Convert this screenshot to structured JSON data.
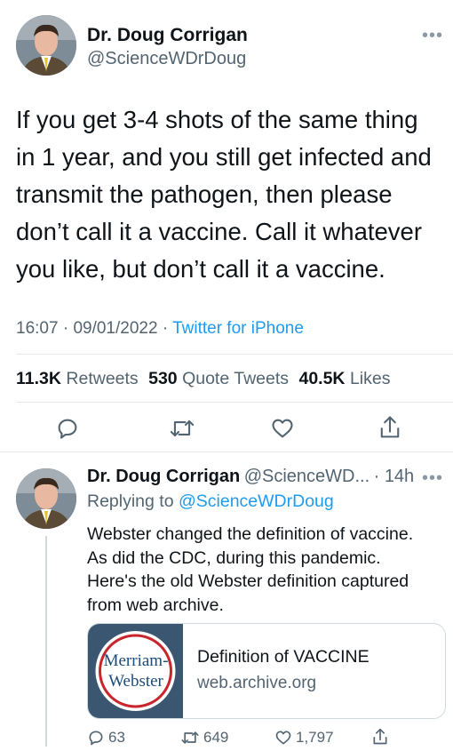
{
  "main_tweet": {
    "author_name": "Dr. Doug Corrigan",
    "author_handle": "@ScienceWDrDoug",
    "more_icon": "more-icon",
    "text_lines": [
      "If you get 3-4 shots of the same thing",
      "in 1 year, and you still get infected and",
      "transmit the pathogen, then please",
      "don’t call it a vaccine. Call it whatever",
      "you like, but don’t call it a vaccine."
    ],
    "time": "16:07",
    "date": "09/01/2022",
    "source": "Twitter for iPhone",
    "retweets_count": "11.3K",
    "retweets_label": "Retweets",
    "quotes_count": "530",
    "quotes_label": "Quote Tweets",
    "likes_count": "40.5K",
    "likes_label": "Likes"
  },
  "reply": {
    "author_name": "Dr. Doug Corrigan",
    "author_handle": "@ScienceWD...",
    "age": "14h",
    "replying_prefix": "Replying to",
    "replying_to": "@ScienceWDrDoug",
    "text_lines": [
      "Webster changed the definition of vaccine.",
      "As did the CDC, during this pandemic.",
      "Here's the old Webster definition captured",
      "from web archive."
    ],
    "card": {
      "logo_line1": "Merriam-",
      "logo_line2": "Webster",
      "title": "Definition of VACCINE",
      "domain": "web.archive.org"
    },
    "replies_count": "63",
    "retweets_count": "649",
    "likes_count": "1,797"
  },
  "colors": {
    "accent": "#1d9bf0",
    "text": "#0f1419",
    "secondary": "#536471",
    "merriam_red": "#c8262c"
  }
}
